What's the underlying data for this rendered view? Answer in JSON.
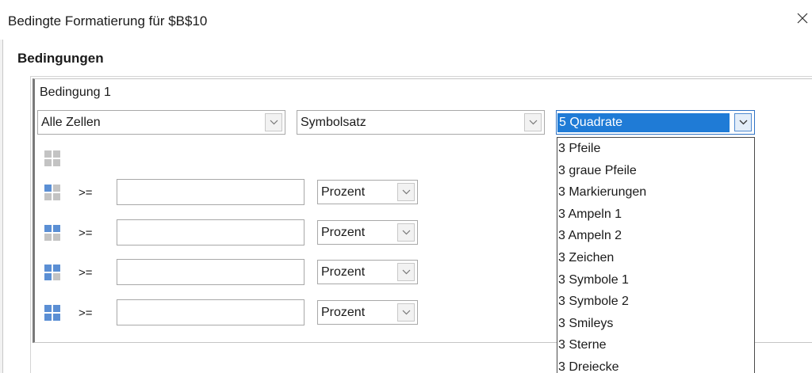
{
  "window": {
    "title": "Bedingte Formatierung für $B$10"
  },
  "section": {
    "heading": "Bedingungen"
  },
  "condition": {
    "label": "Bedingung 1",
    "scope_select": "Alle Zellen",
    "type_select": "Symbolsatz",
    "iconset_select": "5 Quadrate",
    "iconset_options": [
      "3 Pfeile",
      "3 graue Pfeile",
      "3 Markierungen",
      "3 Ampeln 1",
      "3 Ampeln 2",
      "3 Zeichen",
      "3 Symbole 1",
      "3 Symbole 2",
      "3 Smileys",
      "3 Sterne",
      "3 Dreiecke"
    ],
    "rows": [
      {
        "operator": ">=",
        "value": "",
        "unit": "Prozent"
      },
      {
        "operator": ">=",
        "value": "",
        "unit": "Prozent"
      },
      {
        "operator": ">=",
        "value": "",
        "unit": "Prozent"
      },
      {
        "operator": ">=",
        "value": "",
        "unit": "Prozent"
      }
    ]
  },
  "icons": {
    "close": "close-icon",
    "dropdown": "chevron-down-icon",
    "square_set": "squares-icon"
  },
  "colors": {
    "selection": "#1f7bd6",
    "square_empty": "#c3c3c3",
    "square_fill": "#5b8fd4"
  }
}
